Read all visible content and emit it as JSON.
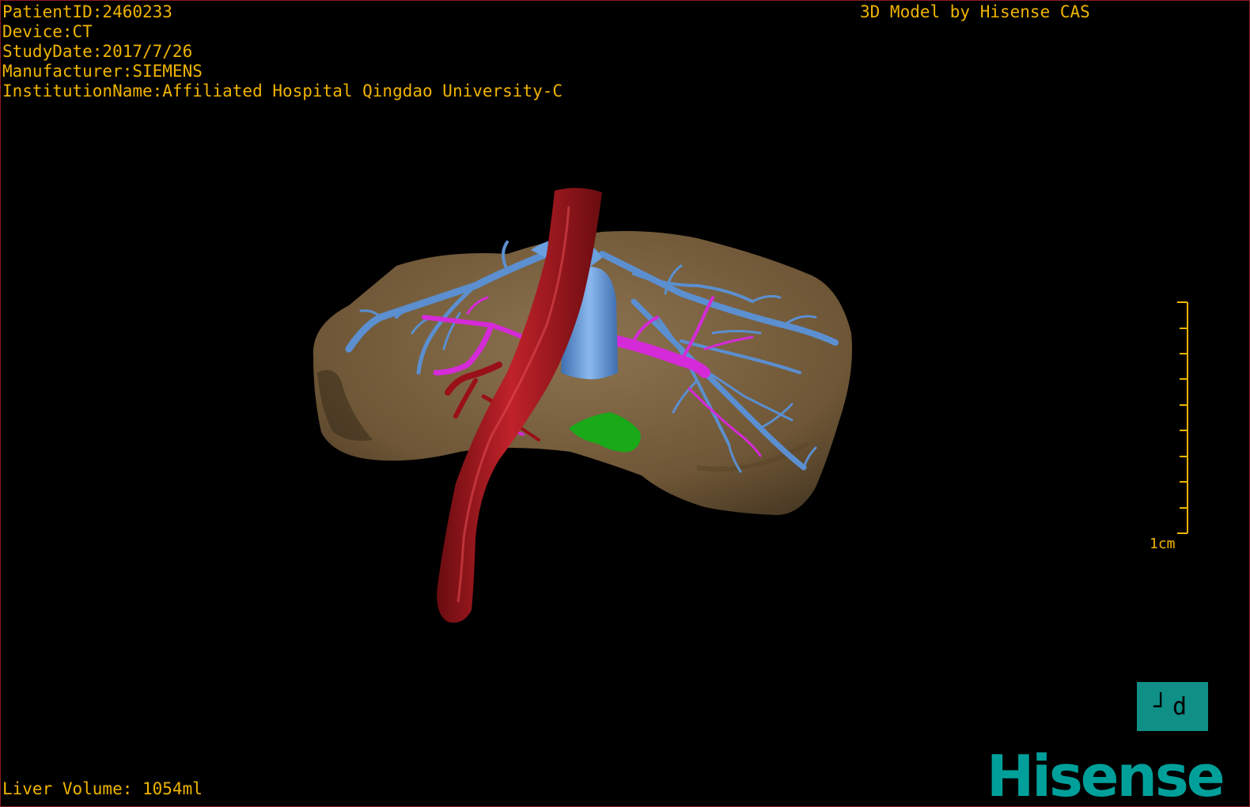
{
  "overlay": {
    "patient_id": "PatientID:2460233",
    "device": "Device:CT",
    "study_date": "StudyDate:2017/7/26",
    "manufacturer": "Manufacturer:SIEMENS",
    "institution": "InstitutionName:Affiliated Hospital Qingdao University-C",
    "model_credit": "3D Model by Hisense CAS",
    "liver_volume": "Liver Volume: 1054ml"
  },
  "scale_bar": {
    "label": "1cm",
    "color": "#f0b400"
  },
  "orientation_marker": {
    "label": "┘d",
    "color": "#0f8f86"
  },
  "brand": {
    "name": "Hisense",
    "color": "#00a09a"
  },
  "model_colors": {
    "liver": "#7a6040",
    "hepatic_veins": "#5b8fd0",
    "portal_veins": "#d52ad8",
    "aorta": "#a0141b",
    "gallbladder": "#19a919",
    "vena_cava": "#6aa0e0"
  }
}
